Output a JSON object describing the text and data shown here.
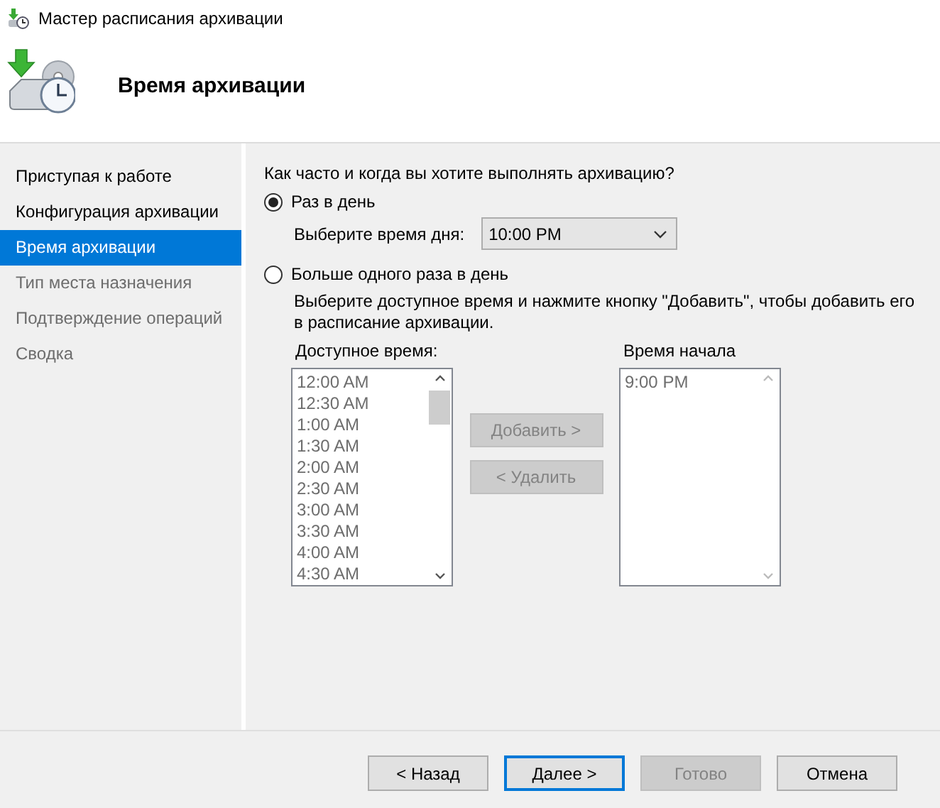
{
  "window": {
    "title": "Мастер расписания архивации"
  },
  "header": {
    "title": "Время архивации"
  },
  "sidebar": {
    "items": [
      {
        "label": "Приступая к работе",
        "selected": false,
        "disabled": false
      },
      {
        "label": "Конфигурация архивации",
        "selected": false,
        "disabled": false
      },
      {
        "label": "Время архивации",
        "selected": true,
        "disabled": false
      },
      {
        "label": "Тип места назначения",
        "selected": false,
        "disabled": true
      },
      {
        "label": "Подтверждение операций",
        "selected": false,
        "disabled": true
      },
      {
        "label": "Сводка",
        "selected": false,
        "disabled": true
      }
    ]
  },
  "question": "Как часто и когда вы хотите выполнять архивацию?",
  "once": {
    "label": "Раз в день",
    "selected": true,
    "time_label": "Выберите время дня:",
    "time_value": "10:00 PM"
  },
  "multiple": {
    "label": "Больше одного раза в день",
    "selected": false,
    "hint": "Выберите доступное время и нажмите кнопку \"Добавить\", чтобы добавить его в расписание архивации.",
    "available": {
      "label": "Доступное время:",
      "disabled": true,
      "items": [
        "12:00 AM",
        "12:30 AM",
        "1:00 AM",
        "1:30 AM",
        "2:00 AM",
        "2:30 AM",
        "3:00 AM",
        "3:30 AM",
        "4:00 AM",
        "4:30 AM"
      ]
    },
    "add_button": {
      "label": "Добавить >",
      "disabled": true
    },
    "remove_button": {
      "label": "< Удалить",
      "disabled": true
    },
    "start": {
      "label": "Время начала",
      "disabled": true,
      "items": [
        "9:00 PM"
      ]
    }
  },
  "buttons": [
    {
      "label": "< Назад",
      "disabled": false,
      "default": false
    },
    {
      "label": "Далее >",
      "disabled": false,
      "default": true
    },
    {
      "label": "Готово",
      "disabled": true,
      "default": false
    },
    {
      "label": "Отмена",
      "disabled": false,
      "default": false
    }
  ]
}
